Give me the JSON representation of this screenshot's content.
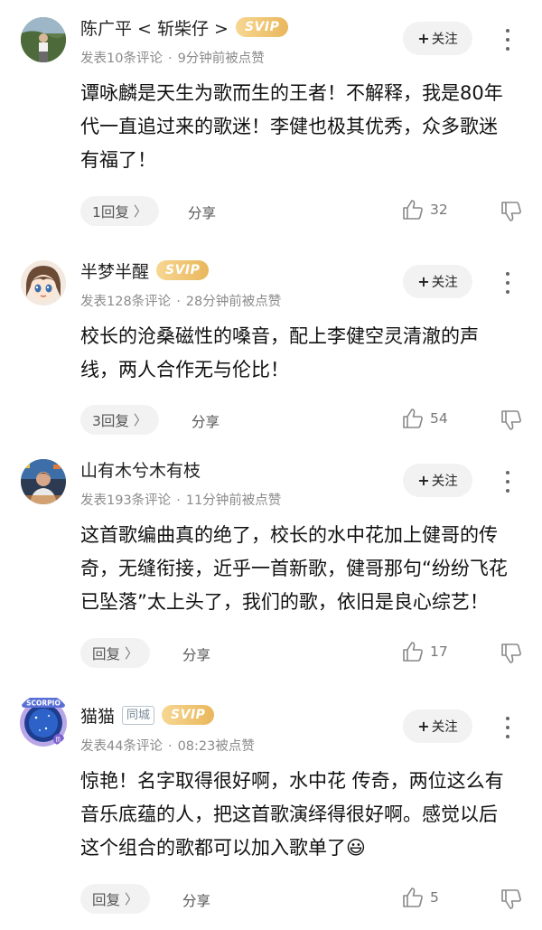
{
  "comments": [
    {
      "username": "陈广平 < 斩柴仔 >",
      "city_badge": "",
      "svip": "SVIP",
      "meta_count": "发表10条评论",
      "meta_time": "9分钟前被点赞",
      "follow_label": "关注",
      "content_lines": [
        "谭咏麟是天生为歌而生的王者！不解释，我是80年",
        "代一直追过来的歌迷！李健也极其优秀，众多歌迷",
        "有福了！"
      ],
      "reply_label": "1回复",
      "share_label": "分享",
      "likes": "32"
    },
    {
      "username": "半梦半醒",
      "city_badge": "",
      "svip": "SVIP",
      "meta_count": "发表128条评论",
      "meta_time": "28分钟前被点赞",
      "follow_label": "关注",
      "content_lines": [
        "校长的沧桑磁性的嗓音，配上李健空灵清澈的声",
        "线，两人合作无与伦比！"
      ],
      "reply_label": "3回复",
      "share_label": "分享",
      "likes": "54"
    },
    {
      "username": "山有木兮木有枝",
      "city_badge": "",
      "svip": "",
      "meta_count": "发表193条评论",
      "meta_time": "11分钟前被点赞",
      "follow_label": "关注",
      "content_lines": [
        "这首歌编曲真的绝了，校长的水中花加上健哥的传",
        "奇，无缝衔接，近乎一首新歌，健哥那句“纷纷飞花",
        "已坠落”太上头了，我们的歌，依旧是良心综艺！"
      ],
      "reply_label": "回复",
      "share_label": "分享",
      "likes": "17"
    },
    {
      "username": "猫猫",
      "city_badge": "同城",
      "svip": "SVIP",
      "meta_count": "发表44条评论",
      "meta_time": "08:23被点赞",
      "follow_label": "关注",
      "content_lines": [
        "惊艳！名字取得很好啊，水中花 传奇，两位这么有",
        "音乐底蕴的人，把这首歌演绎得很好啊。感觉以后",
        "这个组合的歌都可以加入歌单了😃"
      ],
      "reply_label": "回复",
      "share_label": "分享",
      "likes": "5",
      "avatar_text": "SCORPIO"
    }
  ]
}
